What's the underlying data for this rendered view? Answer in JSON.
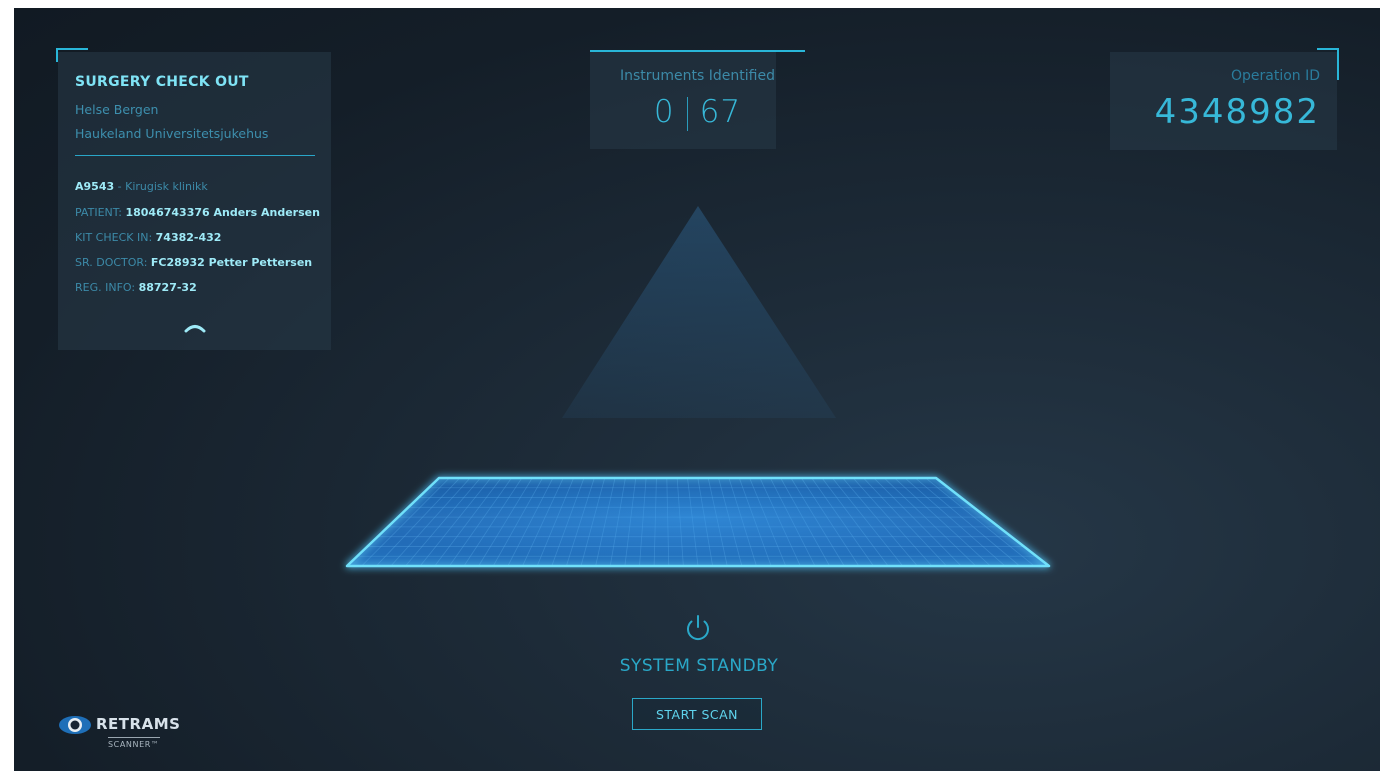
{
  "info": {
    "title": "SURGERY CHECK OUT",
    "org": "Helse Bergen",
    "hospital": "Haukeland Universitetsjukehus",
    "dept_code": "A9543",
    "dept_name": " - Kirugisk klinikk",
    "patient_label": "PATIENT: ",
    "patient_value": "18046743376 Anders Andersen",
    "kit_label": "KIT CHECK IN: ",
    "kit_value": "74382-432",
    "doctor_label": "SR. DOCTOR: ",
    "doctor_value": "FC28932 Petter Pettersen",
    "reg_label": "REG. INFO: ",
    "reg_value": "88727-32",
    "collapse_icon": "chevron-up-icon"
  },
  "instruments": {
    "label": "Instruments Identified",
    "identified": "0",
    "total": "67"
  },
  "operation": {
    "label": "Operation ID",
    "id": "4348982"
  },
  "scanner": {
    "status": "SYSTEM STANDBY",
    "start_label": "START SCAN",
    "power_icon": "power-icon"
  },
  "brand": {
    "name": "RETRAMS",
    "product": "SCANNER™"
  },
  "colors": {
    "accent": "#29b6d8",
    "background": "#1a2633"
  }
}
